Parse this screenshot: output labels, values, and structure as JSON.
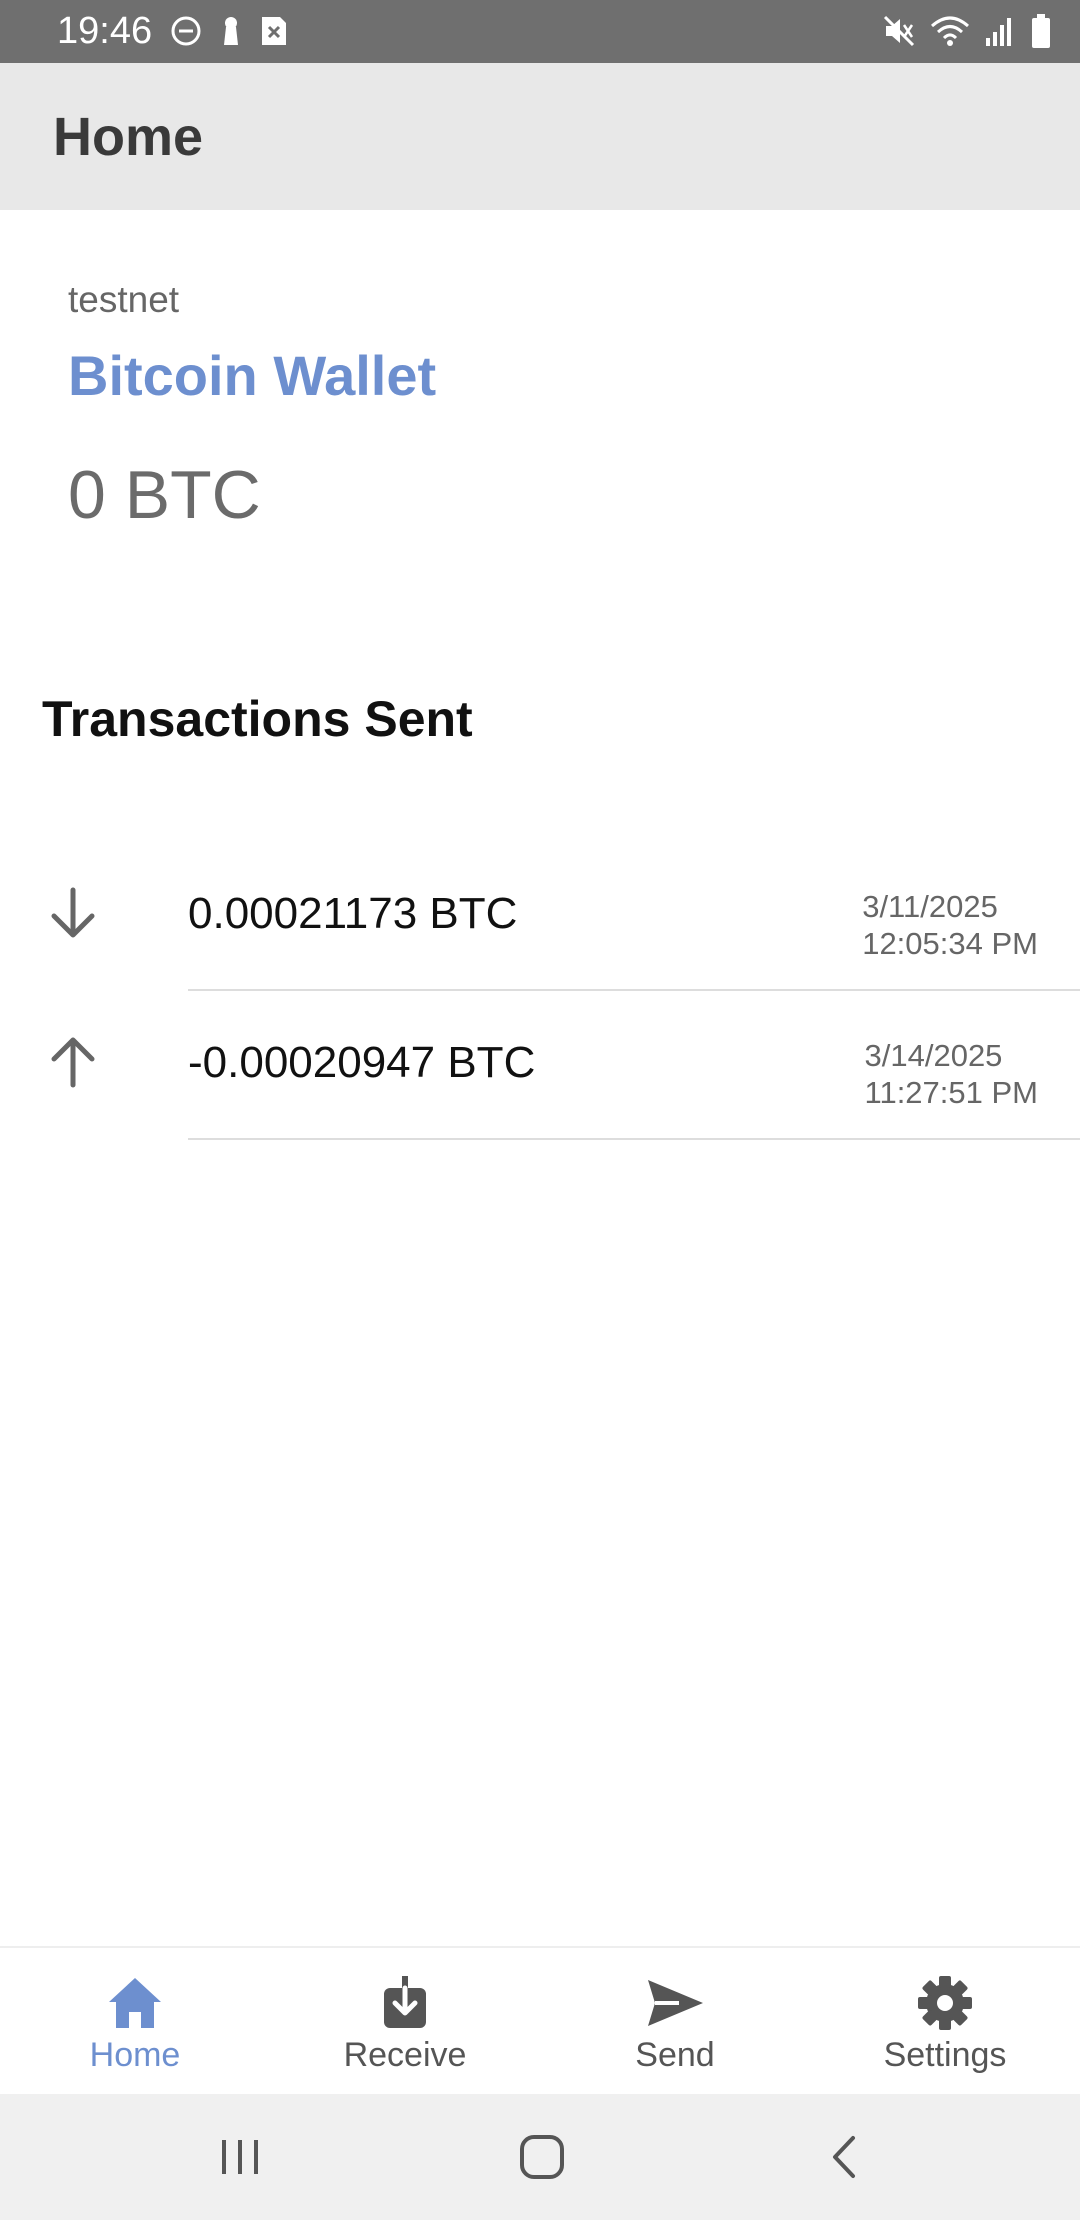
{
  "status_bar": {
    "time": "19:46",
    "left_icons": [
      "do-not-disturb-icon",
      "keyhole-icon",
      "sim-error-icon"
    ],
    "right_icons": [
      "mute-icon",
      "wifi-icon",
      "signal-icon",
      "battery-icon"
    ]
  },
  "app_bar": {
    "title": "Home"
  },
  "wallet": {
    "network": "testnet",
    "name": "Bitcoin Wallet",
    "balance": "0 BTC"
  },
  "transactions": {
    "heading": "Transactions Sent",
    "items": [
      {
        "direction": "incoming",
        "icon": "arrow-down-icon",
        "amount": "0.00021173 BTC",
        "date": "3/11/2025",
        "time": "12:05:34 PM"
      },
      {
        "direction": "outgoing",
        "icon": "arrow-up-icon",
        "amount": "-0.00020947 BTC",
        "date": "3/14/2025",
        "time": "11:27:51 PM"
      }
    ]
  },
  "bottom_nav": {
    "items": [
      {
        "label": "Home",
        "icon": "home-icon",
        "active": true
      },
      {
        "label": "Receive",
        "icon": "download-icon",
        "active": false
      },
      {
        "label": "Send",
        "icon": "send-icon",
        "active": false
      },
      {
        "label": "Settings",
        "icon": "gear-icon",
        "active": false
      }
    ]
  },
  "colors": {
    "accent": "#6d8fcf",
    "status_bar": "#6f6f6f",
    "app_bar": "#e8e8e8",
    "icon_gray": "#555555"
  }
}
